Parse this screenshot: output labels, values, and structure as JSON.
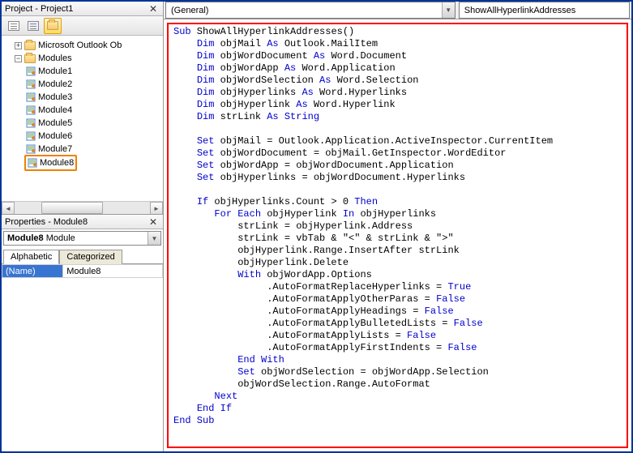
{
  "project_pane": {
    "title": "Project - Project1",
    "toolbar_buttons": [
      "view-code",
      "view-object",
      "toggle-folders"
    ],
    "tree": {
      "root_outlook": "Microsoft Outlook Ob",
      "modules_folder": "Modules",
      "modules": [
        "Module1",
        "Module2",
        "Module3",
        "Module4",
        "Module5",
        "Module6",
        "Module7",
        "Module8"
      ],
      "selected_module_index": 7
    }
  },
  "properties_pane": {
    "title": "Properties - Module8",
    "object_name": "Module8",
    "object_type": "Module",
    "tabs": [
      "Alphabetic",
      "Categorized"
    ],
    "active_tab": 0,
    "rows": [
      {
        "key": "(Name)",
        "value": "Module8"
      }
    ]
  },
  "code_pane": {
    "left_dropdown": "(General)",
    "right_dropdown": "ShowAllHyperlinkAddresses",
    "code_tokens": [
      [
        {
          "t": "Sub",
          "k": 1
        },
        {
          "t": " ShowAllHyperlinkAddresses()",
          "k": 0
        }
      ],
      [
        {
          "t": "    ",
          "k": 0
        },
        {
          "t": "Dim",
          "k": 1
        },
        {
          "t": " objMail ",
          "k": 0
        },
        {
          "t": "As",
          "k": 1
        },
        {
          "t": " Outlook.MailItem",
          "k": 0
        }
      ],
      [
        {
          "t": "    ",
          "k": 0
        },
        {
          "t": "Dim",
          "k": 1
        },
        {
          "t": " objWordDocument ",
          "k": 0
        },
        {
          "t": "As",
          "k": 1
        },
        {
          "t": " Word.Document",
          "k": 0
        }
      ],
      [
        {
          "t": "    ",
          "k": 0
        },
        {
          "t": "Dim",
          "k": 1
        },
        {
          "t": " objWordApp ",
          "k": 0
        },
        {
          "t": "As",
          "k": 1
        },
        {
          "t": " Word.Application",
          "k": 0
        }
      ],
      [
        {
          "t": "    ",
          "k": 0
        },
        {
          "t": "Dim",
          "k": 1
        },
        {
          "t": " objWordSelection ",
          "k": 0
        },
        {
          "t": "As",
          "k": 1
        },
        {
          "t": " Word.Selection",
          "k": 0
        }
      ],
      [
        {
          "t": "    ",
          "k": 0
        },
        {
          "t": "Dim",
          "k": 1
        },
        {
          "t": " objHyperlinks ",
          "k": 0
        },
        {
          "t": "As",
          "k": 1
        },
        {
          "t": " Word.Hyperlinks",
          "k": 0
        }
      ],
      [
        {
          "t": "    ",
          "k": 0
        },
        {
          "t": "Dim",
          "k": 1
        },
        {
          "t": " objHyperlink ",
          "k": 0
        },
        {
          "t": "As",
          "k": 1
        },
        {
          "t": " Word.Hyperlink",
          "k": 0
        }
      ],
      [
        {
          "t": "    ",
          "k": 0
        },
        {
          "t": "Dim",
          "k": 1
        },
        {
          "t": " strLink ",
          "k": 0
        },
        {
          "t": "As",
          "k": 1
        },
        {
          "t": " ",
          "k": 0
        },
        {
          "t": "String",
          "k": 1
        }
      ],
      [],
      [
        {
          "t": "    ",
          "k": 0
        },
        {
          "t": "Set",
          "k": 1
        },
        {
          "t": " objMail = Outlook.Application.ActiveInspector.CurrentItem",
          "k": 0
        }
      ],
      [
        {
          "t": "    ",
          "k": 0
        },
        {
          "t": "Set",
          "k": 1
        },
        {
          "t": " objWordDocument = objMail.GetInspector.WordEditor",
          "k": 0
        }
      ],
      [
        {
          "t": "    ",
          "k": 0
        },
        {
          "t": "Set",
          "k": 1
        },
        {
          "t": " objWordApp = objWordDocument.Application",
          "k": 0
        }
      ],
      [
        {
          "t": "    ",
          "k": 0
        },
        {
          "t": "Set",
          "k": 1
        },
        {
          "t": " objHyperlinks = objWordDocument.Hyperlinks",
          "k": 0
        }
      ],
      [],
      [
        {
          "t": "    ",
          "k": 0
        },
        {
          "t": "If",
          "k": 1
        },
        {
          "t": " objHyperlinks.Count > 0 ",
          "k": 0
        },
        {
          "t": "Then",
          "k": 1
        }
      ],
      [
        {
          "t": "       ",
          "k": 0
        },
        {
          "t": "For Each",
          "k": 1
        },
        {
          "t": " objHyperlink ",
          "k": 0
        },
        {
          "t": "In",
          "k": 1
        },
        {
          "t": " objHyperlinks",
          "k": 0
        }
      ],
      [
        {
          "t": "           strLink = objHyperlink.Address",
          "k": 0
        }
      ],
      [
        {
          "t": "           strLink = vbTab & \"<\" & strLink & \">\"",
          "k": 0
        }
      ],
      [
        {
          "t": "           objHyperlink.Range.InsertAfter strLink",
          "k": 0
        }
      ],
      [
        {
          "t": "           objHyperlink.Delete",
          "k": 0
        }
      ],
      [
        {
          "t": "           ",
          "k": 0
        },
        {
          "t": "With",
          "k": 1
        },
        {
          "t": " objWordApp.Options",
          "k": 0
        }
      ],
      [
        {
          "t": "                .AutoFormatReplaceHyperlinks = ",
          "k": 0
        },
        {
          "t": "True",
          "k": 1
        }
      ],
      [
        {
          "t": "                .AutoFormatApplyOtherParas = ",
          "k": 0
        },
        {
          "t": "False",
          "k": 1
        }
      ],
      [
        {
          "t": "                .AutoFormatApplyHeadings = ",
          "k": 0
        },
        {
          "t": "False",
          "k": 1
        }
      ],
      [
        {
          "t": "                .AutoFormatApplyBulletedLists = ",
          "k": 0
        },
        {
          "t": "False",
          "k": 1
        }
      ],
      [
        {
          "t": "                .AutoFormatApplyLists = ",
          "k": 0
        },
        {
          "t": "False",
          "k": 1
        }
      ],
      [
        {
          "t": "                .AutoFormatApplyFirstIndents = ",
          "k": 0
        },
        {
          "t": "False",
          "k": 1
        }
      ],
      [
        {
          "t": "           ",
          "k": 0
        },
        {
          "t": "End With",
          "k": 1
        }
      ],
      [
        {
          "t": "           ",
          "k": 0
        },
        {
          "t": "Set",
          "k": 1
        },
        {
          "t": " objWordSelection = objWordApp.Selection",
          "k": 0
        }
      ],
      [
        {
          "t": "           objWordSelection.Range.AutoFormat",
          "k": 0
        }
      ],
      [
        {
          "t": "       ",
          "k": 0
        },
        {
          "t": "Next",
          "k": 1
        }
      ],
      [
        {
          "t": "    ",
          "k": 0
        },
        {
          "t": "End If",
          "k": 1
        }
      ],
      [
        {
          "t": "End Sub",
          "k": 1
        }
      ]
    ]
  }
}
